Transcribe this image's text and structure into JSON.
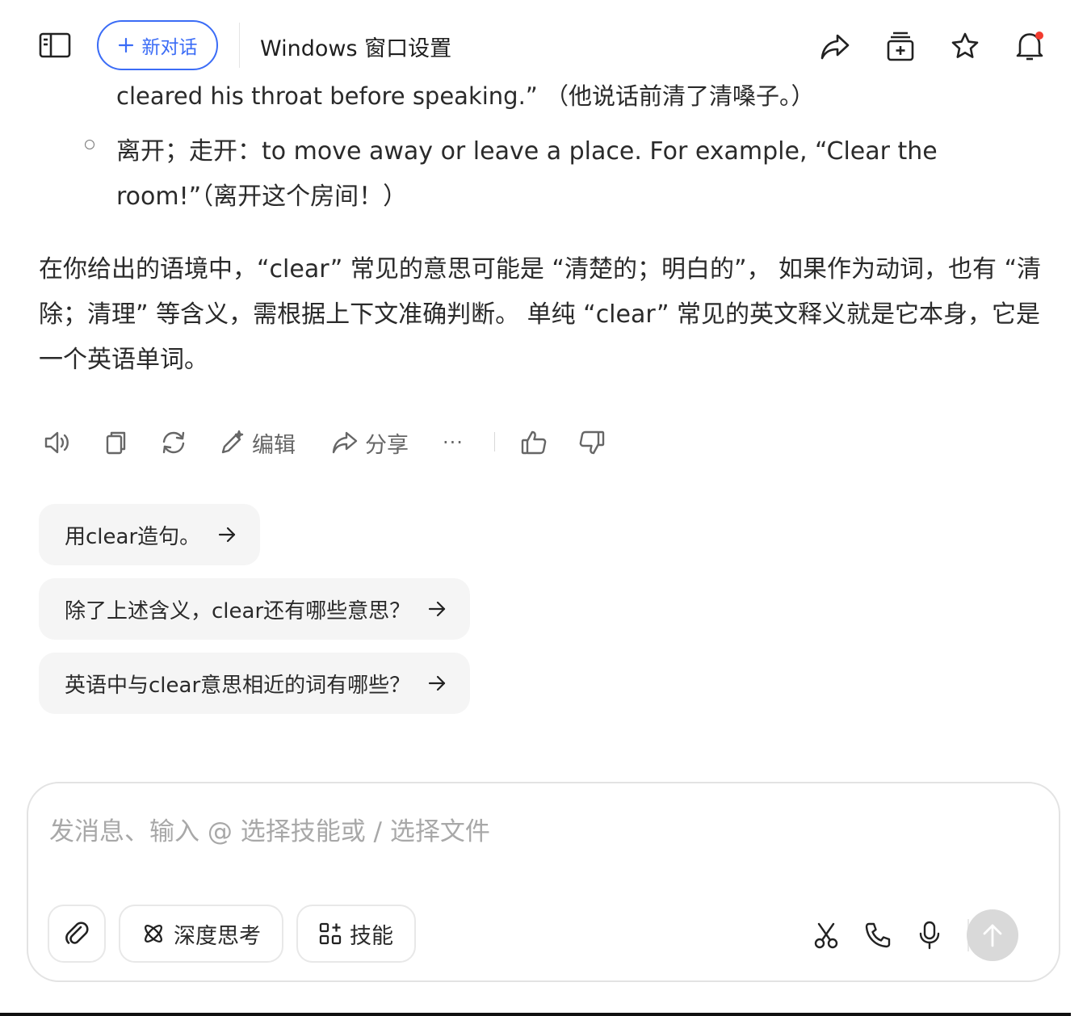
{
  "header": {
    "new_chat_label": "新对话",
    "title": "Windows 窗口设置",
    "icons": [
      "sidebar-icon",
      "share-icon",
      "add-to-collection-icon",
      "star-icon",
      "bell-icon"
    ],
    "notification_dot_color": "#f23b2f"
  },
  "message": {
    "clipped_line": "cleared his throat before speaking.” （他说话前清了清嗓子。）",
    "bullet_text": "离开；走开：to move away or leave a place. For example, “Clear the room!”（离开这个房间！）",
    "paragraph": "在你给出的语境中，“clear” 常见的意思可能是 “清楚的；明白的”， 如果作为动词，也有 “清除；清理” 等含义，需根据上下文准确判断。 单纯 “clear” 常见的英文释义就是它本身，它是一个英语单词。"
  },
  "actions": {
    "edit_label": "编辑",
    "share_label": "分享",
    "more_label": "···"
  },
  "suggestions": [
    {
      "text": "用clear造句。"
    },
    {
      "text": "除了上述含义，clear还有哪些意思？"
    },
    {
      "text": "英语中与clear意思相近的词有哪些？"
    }
  ],
  "input": {
    "placeholder": "发消息、输入 @ 选择技能或 / 选择文件",
    "deep_think_label": "深度思考",
    "skills_label": "技能"
  },
  "colors": {
    "accent": "#3b6cf6",
    "suggestion_bg": "#f5f5f5",
    "send_disabled": "#d9d9d9"
  }
}
